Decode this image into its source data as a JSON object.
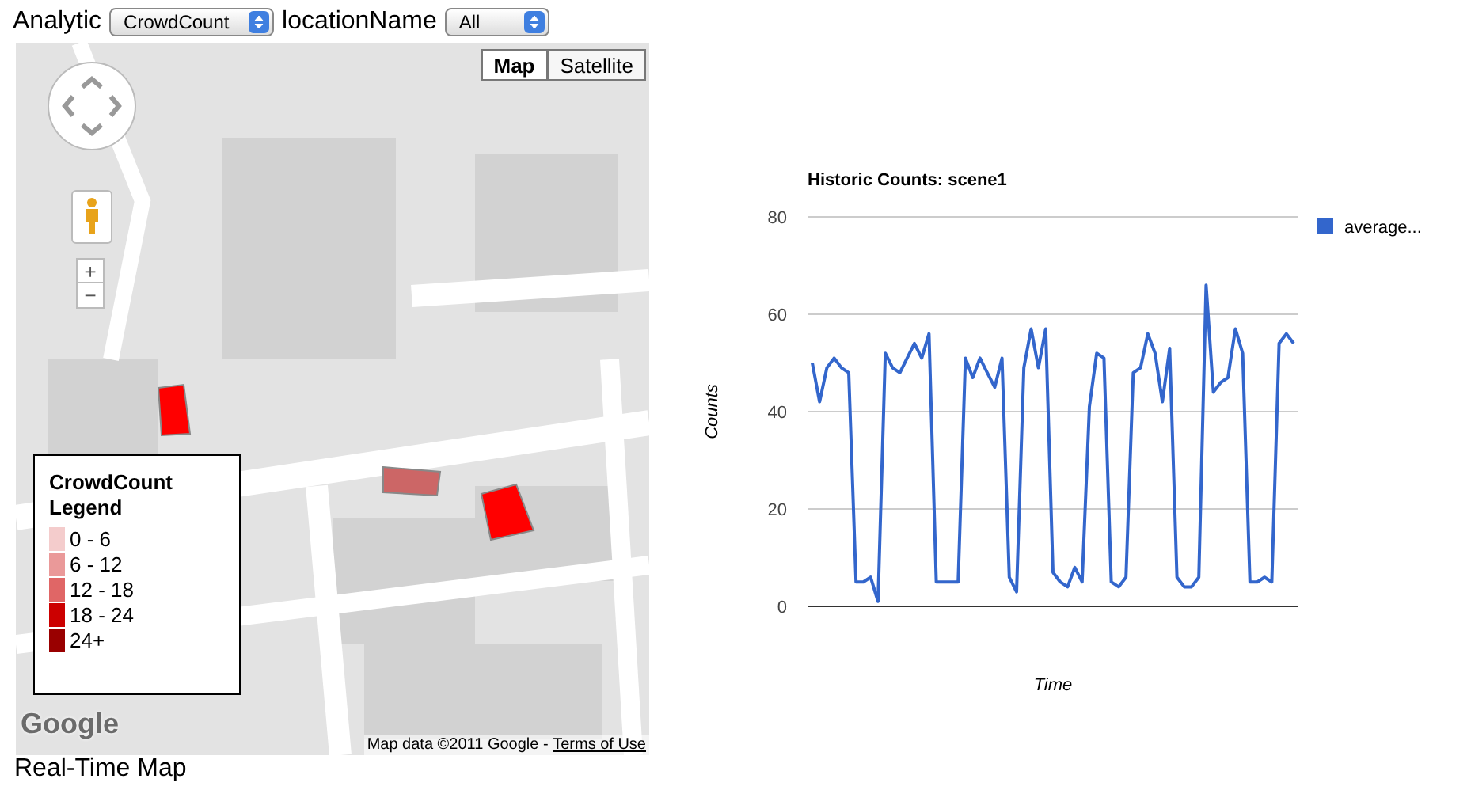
{
  "controls": {
    "analytic": {
      "label": "Analytic",
      "value": "CrowdCount"
    },
    "location": {
      "label": "locationName",
      "value": "All"
    }
  },
  "map": {
    "map_types": [
      {
        "label": "Map",
        "selected": true
      },
      {
        "label": "Satellite",
        "selected": false
      }
    ],
    "zoom_in": "+",
    "zoom_out": "−",
    "regions": [
      {
        "color": "#ff0000"
      },
      {
        "color": "#cc6666"
      },
      {
        "color": "#ff0000"
      }
    ],
    "legend": {
      "title": "CrowdCount Legend",
      "items": [
        {
          "label": "0 - 6",
          "color": "#f4cccc"
        },
        {
          "label": "6 - 12",
          "color": "#ea9999"
        },
        {
          "label": "12 - 18",
          "color": "#e06666"
        },
        {
          "label": "18 - 24",
          "color": "#cc0000"
        },
        {
          "label": "24+",
          "color": "#990000"
        }
      ]
    },
    "logo": "Google",
    "attribution": "Map data ©2011 Google - ",
    "terms_link": "Terms of Use"
  },
  "map_caption": "Real-Time Map",
  "chart": {
    "chart_data": {
      "type": "line",
      "title": "Historic Counts: scene1",
      "xlabel": "Time",
      "ylabel": "Counts",
      "grid": true,
      "ylim": [
        0,
        80
      ],
      "yticks": [
        0,
        20,
        40,
        60,
        80
      ],
      "series": [
        {
          "name": "average...",
          "color": "#3366cc",
          "values": [
            50,
            42,
            49,
            51,
            49,
            48,
            5,
            5,
            6,
            1,
            52,
            49,
            48,
            51,
            54,
            51,
            56,
            5,
            5,
            5,
            5,
            51,
            47,
            51,
            48,
            45,
            51,
            6,
            3,
            49,
            57,
            49,
            57,
            7,
            5,
            4,
            8,
            5,
            41,
            52,
            51,
            5,
            4,
            6,
            48,
            49,
            56,
            52,
            42,
            53,
            6,
            4,
            4,
            6,
            66,
            44,
            46,
            47,
            57,
            52,
            5,
            5,
            6,
            5,
            54,
            56,
            54
          ]
        }
      ]
    }
  }
}
